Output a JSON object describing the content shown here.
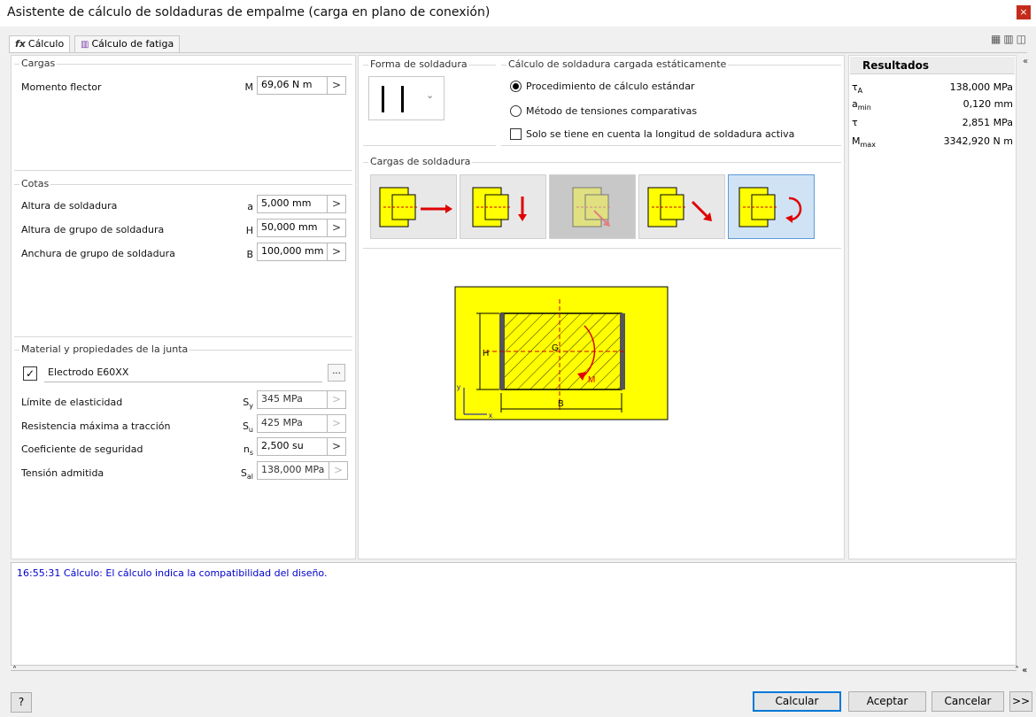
{
  "window": {
    "title": "Asistente de cálculo de soldaduras de empalme (carga en plano de conexión)",
    "close_glyph": "×"
  },
  "tabs": [
    {
      "icon": "fx",
      "label": "Cálculo"
    },
    {
      "label": "Cálculo de fatiga"
    }
  ],
  "loads": {
    "title": "Cargas",
    "rows": [
      {
        "label": "Momento flector",
        "symbol": "M",
        "value": "69,06 N m"
      }
    ]
  },
  "dimensions": {
    "title": "Cotas",
    "rows": [
      {
        "label": "Altura de soldadura",
        "symbol": "a",
        "value": "5,000 mm"
      },
      {
        "label": "Altura de grupo de soldadura",
        "symbol": "H",
        "value": "50,000 mm"
      },
      {
        "label": "Anchura de grupo de soldadura",
        "symbol": "B",
        "value": "100,000 mm"
      }
    ]
  },
  "material": {
    "title": "Material y propiedades de la junta",
    "electrode": "Electrodo E60XX",
    "browse_label": "...",
    "rows": [
      {
        "label": "Límite de elasticidad",
        "symbol": "S",
        "sub": "y",
        "value": "345 MPa"
      },
      {
        "label": "Resistencia máxima a tracción",
        "symbol": "S",
        "sub": "u",
        "value": "425 MPa"
      },
      {
        "label": "Coeficiente de seguridad",
        "symbol": "n",
        "sub": "s",
        "value": "2,500 su"
      },
      {
        "label": "Tensión admitida",
        "symbol": "S",
        "sub": "al",
        "value": "138,000 MPa"
      }
    ]
  },
  "weld_shape": {
    "title": "Forma de soldadura"
  },
  "static_calc": {
    "title": "Cálculo de soldadura cargada estáticamente",
    "option1": "Procedimiento de cálculo estándar",
    "option2": "Método de tensiones comparativas",
    "checkbox": "Solo se tiene en cuenta la longitud de soldadura activa"
  },
  "weld_loads": {
    "title": "Cargas de soldadura"
  },
  "diagram": {
    "label_h": "H",
    "label_b": "B",
    "label_g": "G",
    "label_m": "M",
    "label_x": "x",
    "label_y": "y"
  },
  "results": {
    "title": "Resultados",
    "rows": [
      {
        "symbol": "τ",
        "sub": "A",
        "value": "138,000 MPa"
      },
      {
        "symbol": "a",
        "sub": "min",
        "value": "0,120 mm"
      },
      {
        "symbol": "τ",
        "sub": "",
        "value": "2,851 MPa"
      },
      {
        "symbol": "M",
        "sub": "max",
        "value": "3342,920 N m"
      }
    ]
  },
  "log": {
    "message": "16:55:31 Cálculo: El cálculo indica la compatibilidad del diseño."
  },
  "footer": {
    "help": "?",
    "calc": "Calcular",
    "ok": "Aceptar",
    "cancel": "Cancelar",
    "more": ">>"
  },
  "colors": {
    "yellow": "#ffff00",
    "accent": "#0078d7",
    "log_text": "#0000cc",
    "arrow_red": "#e00000"
  }
}
